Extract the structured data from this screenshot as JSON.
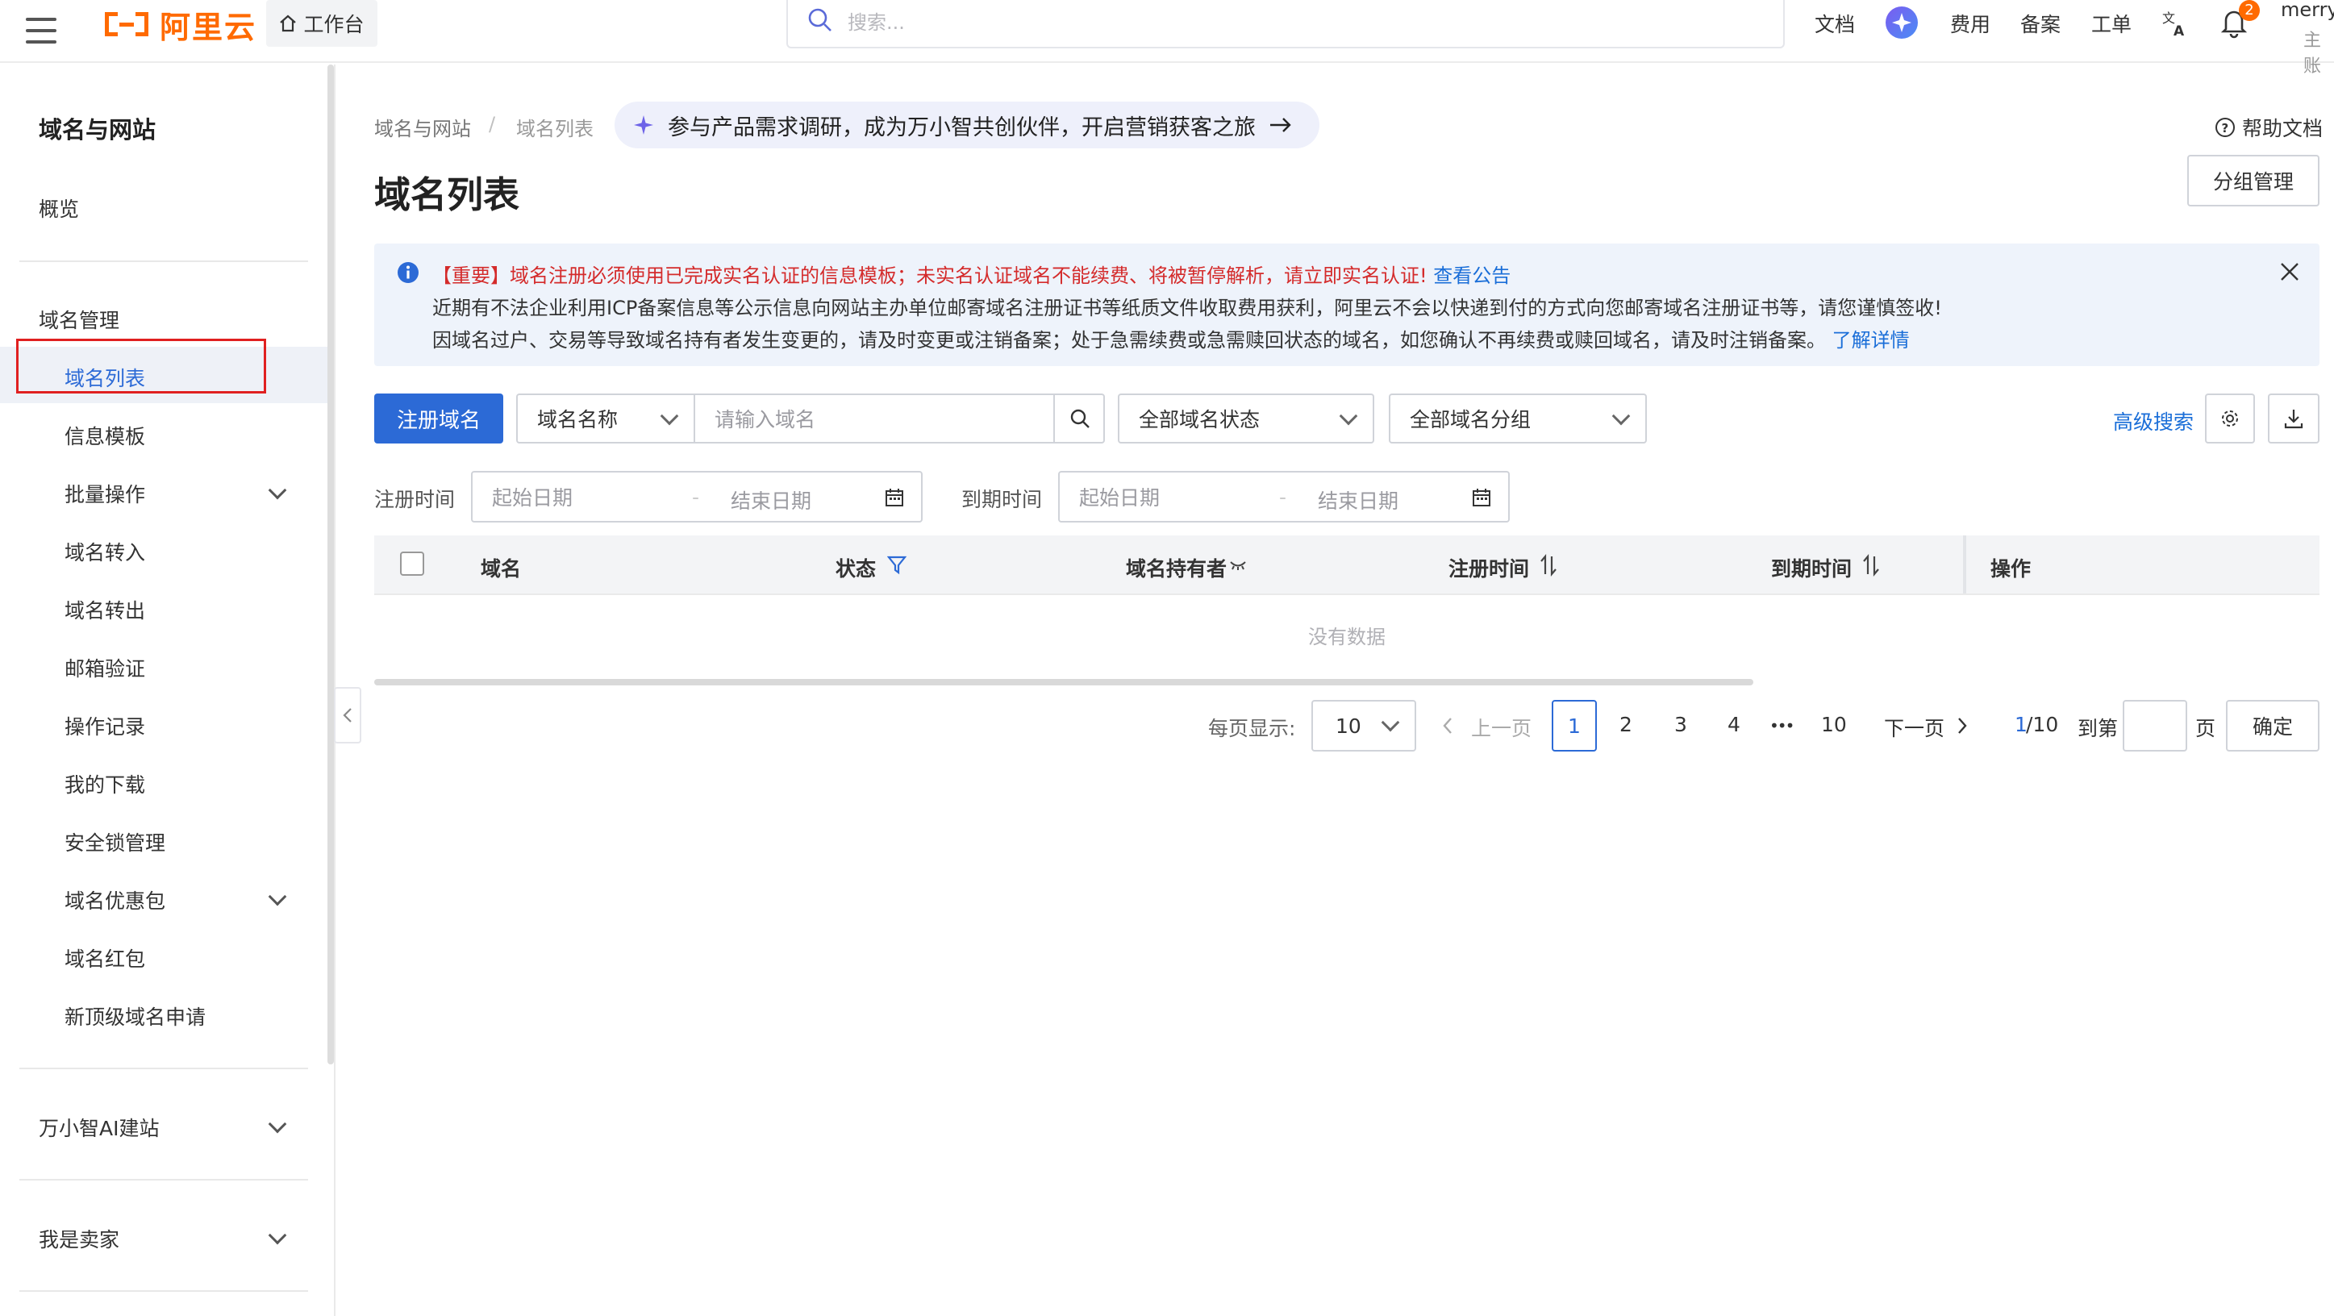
{
  "topbar": {
    "logo_text": "阿里云",
    "workbench": "工作台",
    "search_placeholder": "搜索...",
    "nav": [
      "文档",
      "费用",
      "备案",
      "工单"
    ],
    "notification_count": "2",
    "user_name": "merry",
    "user_role": "主账"
  },
  "sidebar": {
    "title": "域名与网站",
    "overview": "概览",
    "section_domain_mgmt": "域名管理",
    "items": [
      "域名列表",
      "信息模板",
      "批量操作",
      "域名转入",
      "域名转出",
      "邮箱验证",
      "操作记录",
      "我的下载",
      "安全锁管理",
      "域名优惠包",
      "域名红包",
      "新顶级域名申请"
    ],
    "group_ai": "万小智AI建站",
    "group_seller": "我是卖家"
  },
  "breadcrumb": [
    "域名与网站",
    "域名列表"
  ],
  "promo_text": "参与产品需求调研，成为万小智共创伙伴，开启营销获客之旅",
  "page_title": "域名列表",
  "help_label": "帮助文档",
  "group_manage_label": "分组管理",
  "notice": {
    "line1_red": "【重要】域名注册必须使用已完成实名认证的信息模板；未实名认证域名不能续费、将被暂停解析，请立即实名认证!",
    "line1_link": "查看公告",
    "line2": "近期有不法企业利用ICP备案信息等公示信息向网站主办单位邮寄域名注册证书等纸质文件收取费用获利，阿里云不会以快递到付的方式向您邮寄域名注册证书等，请您谨慎签收!",
    "line3": "因域名过户、交易等导致域名持有者发生变更的，请及时变更或注销备案；处于急需续费或急需赎回状态的域名，如您确认不再续费或赎回域名，请及时注销备案。",
    "line3_link": "了解详情"
  },
  "toolbar": {
    "register_label": "注册域名",
    "field_type": "域名名称",
    "domain_placeholder": "请输入域名",
    "status_select": "全部域名状态",
    "group_select": "全部域名分组",
    "advanced_search": "高级搜索"
  },
  "filters": {
    "reg_time_label": "注册时间",
    "exp_time_label": "到期时间",
    "start_placeholder": "起始日期",
    "end_placeholder": "结束日期"
  },
  "table": {
    "columns": [
      "域名",
      "状态",
      "域名持有者",
      "注册时间",
      "到期时间",
      "操作"
    ],
    "empty_text": "没有数据"
  },
  "pagination": {
    "per_page_label": "每页显示:",
    "per_page_value": "10",
    "prev": "上一页",
    "pages": [
      "1",
      "2",
      "3",
      "4",
      "10"
    ],
    "ellipsis": "•••",
    "next": "下一页",
    "current": "1",
    "total": "/10",
    "goto_label": "到第",
    "page_unit": "页",
    "confirm": "确定"
  },
  "colors": {
    "brand": "#ff6a00",
    "primary": "#2c6ad6",
    "warning": "#d42b2b",
    "link": "#1a6ed8"
  }
}
